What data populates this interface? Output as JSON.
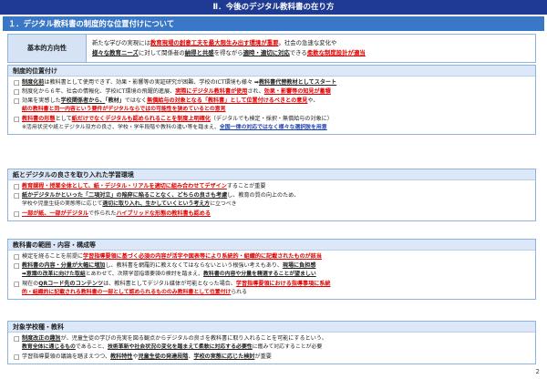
{
  "header": {
    "title": "Ⅱ．今後のデジタル教科書の在り方"
  },
  "section": {
    "title": "１．デジタル教科書の制度的な位置付けについて"
  },
  "basic": {
    "label": "基本的方向性",
    "l1a": "新たな学びの実現には",
    "l1b": "教育現場の創意工夫を最大限生み出す環境が重要",
    "l1c": "。社会の急速な変化や",
    "l2a": "様々な教育ニーズ",
    "l2b": "に対して関係者の",
    "l2c": "納得と共感",
    "l2d": "を得ながら",
    "l2e": "適時・適切に対応",
    "l2f": "できる",
    "l2g": "柔軟な制度設計が適当"
  },
  "p1": {
    "head": "制度的位置付け",
    "i1a": "制度化前",
    "i1b": "は教科書として使用できず、効果・影響等の実証研究が困難、",
    "i1c": "学校のICT環境も様々 ➡",
    "i1d": "教科書代替教材としてスタート",
    "i2a": "制度化から６年、社会の情報化、学校ICT環境の飛躍的進展、",
    "i2b": "実際にデジタル教科書が使用",
    "i2c": "され、",
    "i2d": "効果・影響等の知見が蓄積",
    "i3a": "効果を実感した",
    "i3b": "学校関係者から、",
    "i3c": "「教材」",
    "i3d": "ではなく",
    "i3e": "無償給与の対象となる「教科書」として位置付けるべきとの意見",
    "i3f": "や、",
    "i3g": "紙の教科書と同一内容という要件がデジタルならではの可能性を狭めているとの意見",
    "i4a": "教科書の形態",
    "i4b": "として",
    "i4c": "紙だけでなくデジタルも認められることを制度上明確化",
    "i4d": "（デジタルでも検定・採択・無償給与の対象に）",
    "s4a": "※活用状況や紙とデジタル双方の良さ、学校・学年段階や教科の違い等を踏まえ、",
    "s4b": "全国一律の対応ではなく様々な選択肢を用意"
  },
  "p2": {
    "head": "紙とデジタルの良さを取り入れた学習環境",
    "i1a": "教育課程・授業全体として、紙・デジタル・リアルを適切に組み合わせてデザイン",
    "i1b": "することが重要",
    "i2a": "紙かデジタルかといった「二項対立」の陥穽に陥ることなく、どちらの良さも考慮",
    "i2b": "し、教育の質の向上のため、",
    "s2a": "学校や児童生徒の実態等に応じて",
    "s2b": "適切に取り入れ、生かしていくという考え方",
    "s2c": "に立つべき",
    "i3a": "一部が紙、一部がデジタル",
    "i3b": "で作られた",
    "i3c": "ハイブリッドな形態の教科書も認める"
  },
  "p3": {
    "head": "教科書の範囲・内容・構成等",
    "i1a": "検定を経ることを前提に",
    "i1b": "学習指導要領に基づく必須の内容が活字や図表等により系統的・組織的に記載されたものが該当",
    "i2a": "教科書の内容・分量が大幅に増加",
    "i2b": "し、教科書を網羅的に教えなくてはならないという根強い考えもあり、",
    "i2c": "現場に負担感",
    "s2a": "➡意識の改革に向けた取組",
    "s2b": "とあわせて、次期学習指導要領の検討を踏まえ、",
    "s2c": "教科書の内容や分量を精選することが望ましい",
    "i3a": "現在の",
    "i3b": "QRコード先のコンテンツ",
    "i3c": "は、教科書としてデジタル媒体が可能となった場合、",
    "i3d": "学習指導要領における指導事項に系統",
    "s3a": "的・組織的に記載される教科書の一部として認められるもののみ教科書として位置付け",
    "s3b": "られる"
  },
  "p4": {
    "head": "対象学校種・教科",
    "i1a": "制度改正の趣旨",
    "i1b": "が、児童生徒の学びの充実を図る観点からデジタルの良さを教科書に取り入れることを可能にするという、",
    "s1a": "教育全体に通じるもの",
    "s1b": "であること、",
    "s1c": "技術革新や社会状況の変化を踏まえて柔軟に対応する必要性",
    "s1d": "に鑑みて対応することが必要",
    "i2a": "学習指導要領の議論を踏まえつつ、",
    "i2b": "教科特性",
    "i2c": "や",
    "i2d": "児童生徒の発達段階",
    "i2e": "、",
    "i2f": "学校の実態に応じた検討",
    "i2g": "が重要"
  },
  "page": {
    "number": "2"
  },
  "icons": {
    "bullet": "□"
  }
}
